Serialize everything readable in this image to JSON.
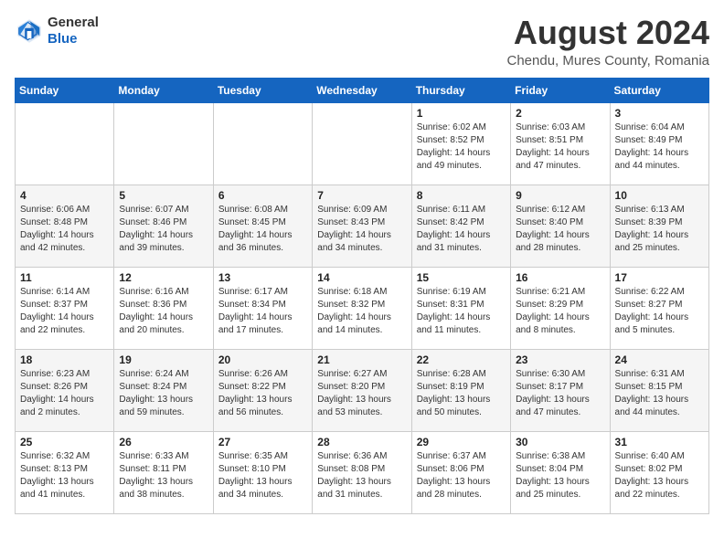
{
  "header": {
    "logo_line1": "General",
    "logo_line2": "Blue",
    "main_title": "August 2024",
    "subtitle": "Chendu, Mures County, Romania"
  },
  "calendar": {
    "days_of_week": [
      "Sunday",
      "Monday",
      "Tuesday",
      "Wednesday",
      "Thursday",
      "Friday",
      "Saturday"
    ],
    "weeks": [
      [
        {
          "day": "",
          "info": ""
        },
        {
          "day": "",
          "info": ""
        },
        {
          "day": "",
          "info": ""
        },
        {
          "day": "",
          "info": ""
        },
        {
          "day": "1",
          "info": "Sunrise: 6:02 AM\nSunset: 8:52 PM\nDaylight: 14 hours and 49 minutes."
        },
        {
          "day": "2",
          "info": "Sunrise: 6:03 AM\nSunset: 8:51 PM\nDaylight: 14 hours and 47 minutes."
        },
        {
          "day": "3",
          "info": "Sunrise: 6:04 AM\nSunset: 8:49 PM\nDaylight: 14 hours and 44 minutes."
        }
      ],
      [
        {
          "day": "4",
          "info": "Sunrise: 6:06 AM\nSunset: 8:48 PM\nDaylight: 14 hours and 42 minutes."
        },
        {
          "day": "5",
          "info": "Sunrise: 6:07 AM\nSunset: 8:46 PM\nDaylight: 14 hours and 39 minutes."
        },
        {
          "day": "6",
          "info": "Sunrise: 6:08 AM\nSunset: 8:45 PM\nDaylight: 14 hours and 36 minutes."
        },
        {
          "day": "7",
          "info": "Sunrise: 6:09 AM\nSunset: 8:43 PM\nDaylight: 14 hours and 34 minutes."
        },
        {
          "day": "8",
          "info": "Sunrise: 6:11 AM\nSunset: 8:42 PM\nDaylight: 14 hours and 31 minutes."
        },
        {
          "day": "9",
          "info": "Sunrise: 6:12 AM\nSunset: 8:40 PM\nDaylight: 14 hours and 28 minutes."
        },
        {
          "day": "10",
          "info": "Sunrise: 6:13 AM\nSunset: 8:39 PM\nDaylight: 14 hours and 25 minutes."
        }
      ],
      [
        {
          "day": "11",
          "info": "Sunrise: 6:14 AM\nSunset: 8:37 PM\nDaylight: 14 hours and 22 minutes."
        },
        {
          "day": "12",
          "info": "Sunrise: 6:16 AM\nSunset: 8:36 PM\nDaylight: 14 hours and 20 minutes."
        },
        {
          "day": "13",
          "info": "Sunrise: 6:17 AM\nSunset: 8:34 PM\nDaylight: 14 hours and 17 minutes."
        },
        {
          "day": "14",
          "info": "Sunrise: 6:18 AM\nSunset: 8:32 PM\nDaylight: 14 hours and 14 minutes."
        },
        {
          "day": "15",
          "info": "Sunrise: 6:19 AM\nSunset: 8:31 PM\nDaylight: 14 hours and 11 minutes."
        },
        {
          "day": "16",
          "info": "Sunrise: 6:21 AM\nSunset: 8:29 PM\nDaylight: 14 hours and 8 minutes."
        },
        {
          "day": "17",
          "info": "Sunrise: 6:22 AM\nSunset: 8:27 PM\nDaylight: 14 hours and 5 minutes."
        }
      ],
      [
        {
          "day": "18",
          "info": "Sunrise: 6:23 AM\nSunset: 8:26 PM\nDaylight: 14 hours and 2 minutes."
        },
        {
          "day": "19",
          "info": "Sunrise: 6:24 AM\nSunset: 8:24 PM\nDaylight: 13 hours and 59 minutes."
        },
        {
          "day": "20",
          "info": "Sunrise: 6:26 AM\nSunset: 8:22 PM\nDaylight: 13 hours and 56 minutes."
        },
        {
          "day": "21",
          "info": "Sunrise: 6:27 AM\nSunset: 8:20 PM\nDaylight: 13 hours and 53 minutes."
        },
        {
          "day": "22",
          "info": "Sunrise: 6:28 AM\nSunset: 8:19 PM\nDaylight: 13 hours and 50 minutes."
        },
        {
          "day": "23",
          "info": "Sunrise: 6:30 AM\nSunset: 8:17 PM\nDaylight: 13 hours and 47 minutes."
        },
        {
          "day": "24",
          "info": "Sunrise: 6:31 AM\nSunset: 8:15 PM\nDaylight: 13 hours and 44 minutes."
        }
      ],
      [
        {
          "day": "25",
          "info": "Sunrise: 6:32 AM\nSunset: 8:13 PM\nDaylight: 13 hours and 41 minutes."
        },
        {
          "day": "26",
          "info": "Sunrise: 6:33 AM\nSunset: 8:11 PM\nDaylight: 13 hours and 38 minutes."
        },
        {
          "day": "27",
          "info": "Sunrise: 6:35 AM\nSunset: 8:10 PM\nDaylight: 13 hours and 34 minutes."
        },
        {
          "day": "28",
          "info": "Sunrise: 6:36 AM\nSunset: 8:08 PM\nDaylight: 13 hours and 31 minutes."
        },
        {
          "day": "29",
          "info": "Sunrise: 6:37 AM\nSunset: 8:06 PM\nDaylight: 13 hours and 28 minutes."
        },
        {
          "day": "30",
          "info": "Sunrise: 6:38 AM\nSunset: 8:04 PM\nDaylight: 13 hours and 25 minutes."
        },
        {
          "day": "31",
          "info": "Sunrise: 6:40 AM\nSunset: 8:02 PM\nDaylight: 13 hours and 22 minutes."
        }
      ]
    ]
  }
}
